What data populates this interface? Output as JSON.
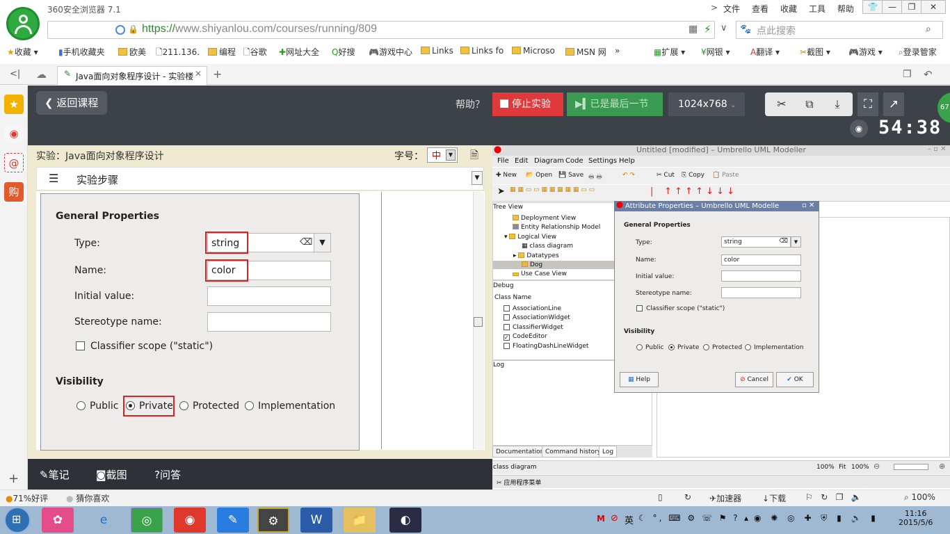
{
  "browser": {
    "app_name": "360安全浏览器 7.1",
    "menu": [
      "文件",
      "查看",
      "收藏",
      "工具",
      "帮助"
    ],
    "url_scheme": "https://",
    "url_host": "www.shiyanlou.com",
    "url_path": "/courses/running/809",
    "search_placeholder": "点此搜索",
    "bookmarks": [
      "收藏",
      "手机收藏夹",
      "欧美",
      "211.136.",
      "编程",
      "谷歌",
      "网址大全",
      "好搜",
      "游戏中心",
      "Links",
      "Links fo",
      "Microso",
      "MSN 网"
    ],
    "bookmarks_right": [
      "扩展",
      "网银",
      "翻译",
      "截图",
      "游戏",
      "登录管家"
    ],
    "tab_title": "Java面向对象程序设计 - 实验楼"
  },
  "page": {
    "back_label": "返回课程",
    "help_label": "帮助？",
    "stop_label": "停止实验",
    "last_label": "已是最后一节",
    "resolution": "1024x768",
    "timer": "54:38",
    "badge": "67",
    "exp_title": "实验：Java面向对象程序设计",
    "font_size_label": "字号：",
    "font_size_value": "中",
    "steps_label": "实验步骤",
    "bottom": {
      "notes": "笔记",
      "screenshot": "截图",
      "qa": "问答"
    }
  },
  "shot": {
    "general_properties": "General Properties",
    "type_label": "Type:",
    "type_value": "string",
    "name_label": "Name:",
    "name_value": "color",
    "initial_label": "Initial value:",
    "stereotype_label": "Stereotype name:",
    "classifier_label": "Classifier scope (\"static\")",
    "visibility": "Visibility",
    "public": "Public",
    "private": "Private",
    "protected": "Protected",
    "implementation": "Implementation"
  },
  "vm": {
    "title": "Untitled [modified] – Umbrello UML Modeller",
    "menu": [
      "File",
      "Edit",
      "Diagram",
      "Code",
      "Settings",
      "Help"
    ],
    "toolbar": [
      "New",
      "Open",
      "Save",
      "Cut",
      "Copy",
      "Paste"
    ],
    "tree_view": "Tree View",
    "tree": [
      "Deployment View",
      "Entity Relationship Model",
      "Logical View",
      "class diagram",
      "Datatypes",
      "Dog",
      "Use Case View"
    ],
    "debug": "Debug",
    "class_name": "Class Name",
    "classes": [
      "AssociationLine",
      "AssociationWidget",
      "ClassifierWidget",
      "CodeEditor",
      "FloatingDashLineWidget"
    ],
    "log": "Log",
    "tabs": [
      "Documentation",
      "Command history",
      "Log"
    ],
    "status_left": "class diagram",
    "zoom1": "100%",
    "fit": "Fit",
    "zoom2": "100%",
    "taskbar_label": "应用程序菜单",
    "attr": {
      "title": "Attribute Properties – Umbrello UML Modelle",
      "general": "General Properties",
      "type_label": "Type:",
      "type_value": "string",
      "name_label": "Name:",
      "name_value": "color",
      "initial_label": "Initial value:",
      "stereotype_label": "Stereotype name:",
      "classifier": "Classifier scope (\"static\")",
      "visibility": "Visibility",
      "public": "Public",
      "private": "Private",
      "protected": "Protected",
      "implementation": "Implementation",
      "help": "Help",
      "cancel": "Cancel",
      "ok": "OK"
    }
  },
  "statusbar": {
    "rating": "71%好评",
    "guess": "猜你喜欢",
    "accelerator": "加速器",
    "download": "下载",
    "zoom": "100%"
  },
  "taskbar": {
    "time": "11:16",
    "date": "2015/5/6",
    "ime": "英"
  }
}
